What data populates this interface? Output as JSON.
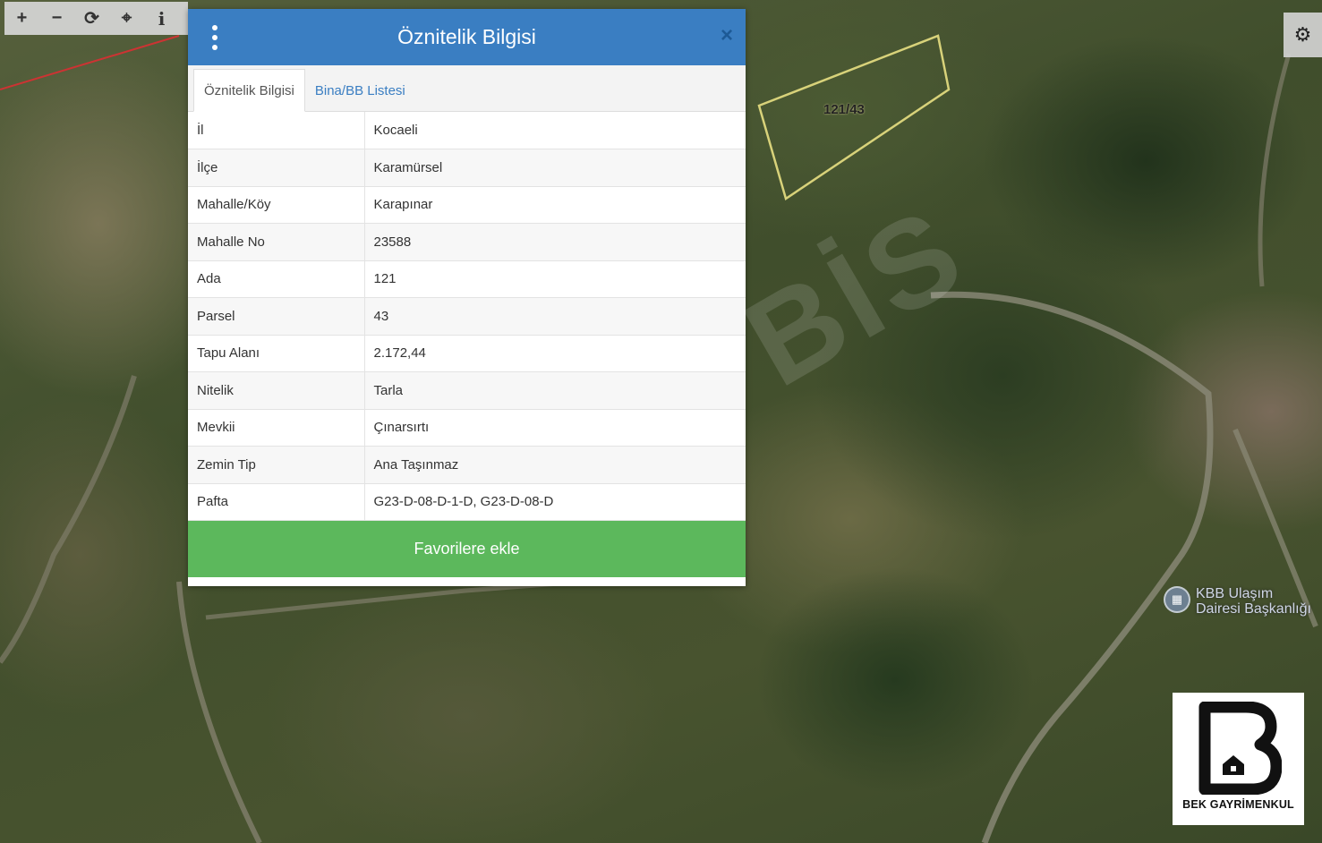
{
  "toolbar": {
    "zoom_in": "+",
    "zoom_out": "−",
    "refresh": "⟳",
    "locate": "⌖",
    "info": "i"
  },
  "settings_icon": "⚙",
  "map": {
    "parcel_label": "121/43",
    "watermark": "BİS",
    "poi_text": "KBB Ulaşım\nDairesi Başkanlığı"
  },
  "popup": {
    "title": "Öznitelik Bilgisi",
    "close": "×",
    "tabs": [
      {
        "label": "Öznitelik Bilgisi",
        "active": true
      },
      {
        "label": "Bina/BB Listesi",
        "active": false
      }
    ],
    "rows": [
      {
        "key": "İl",
        "value": "Kocaeli"
      },
      {
        "key": "İlçe",
        "value": "Karamürsel"
      },
      {
        "key": "Mahalle/Köy",
        "value": "Karapınar"
      },
      {
        "key": "Mahalle No",
        "value": "23588"
      },
      {
        "key": "Ada",
        "value": "121"
      },
      {
        "key": "Parsel",
        "value": "43"
      },
      {
        "key": "Tapu Alanı",
        "value": "2.172,44"
      },
      {
        "key": "Nitelik",
        "value": "Tarla"
      },
      {
        "key": "Mevkii",
        "value": "Çınarsırtı"
      },
      {
        "key": "Zemin Tip",
        "value": "Ana Taşınmaz"
      },
      {
        "key": "Pafta",
        "value": "G23-D-08-D-1-D, G23-D-08-D"
      }
    ],
    "favorite_button": "Favorilere ekle"
  },
  "logo": {
    "text": "BEK GAYRİMENKUL"
  },
  "colors": {
    "header_blue": "#3a7ec2",
    "favorite_green": "#5cb85c",
    "parcel_outline": "#d8d27a"
  }
}
